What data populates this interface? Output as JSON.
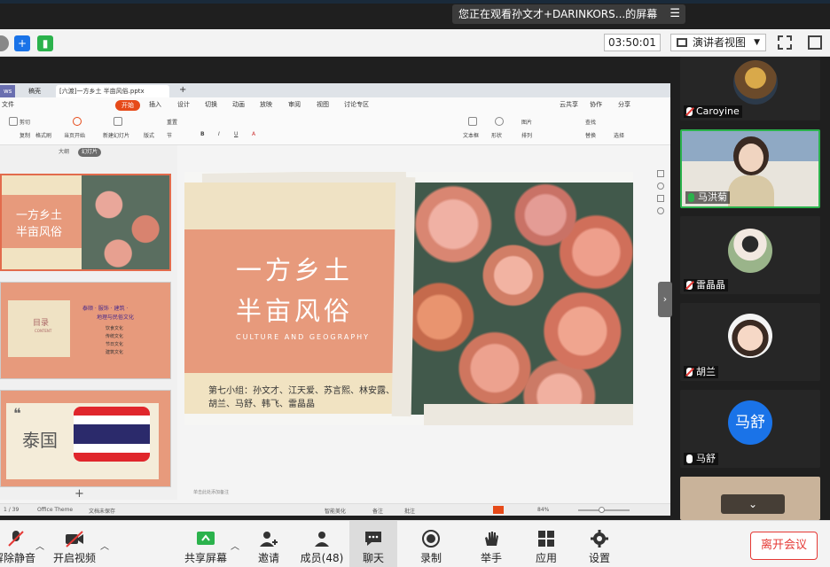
{
  "banner": {
    "text": "您正在观看孙文才+DARINKORS...的屏幕",
    "menu_icon": "menu-icon"
  },
  "meeting_bar": {
    "timer": "03:50:01",
    "view_label": "演讲者视图"
  },
  "wps": {
    "tabs": [
      "稿壳",
      "[六渡]一方乡土 半亩风俗.pptx"
    ],
    "file_menu": "文件",
    "start_tab": "开始",
    "menu_items": [
      "插入",
      "设计",
      "切换",
      "动画",
      "放映",
      "审阅",
      "视图",
      "讨论专区"
    ],
    "menu_right": [
      "云共享",
      "协作",
      "分享"
    ],
    "ribbon_items": [
      "剪切",
      "复制",
      "格式刷",
      "当页开始",
      "新建幻灯片",
      "版式",
      "节",
      "重置",
      "文本框",
      "形状",
      "图片",
      "排列",
      "查找",
      "替换",
      "选择"
    ],
    "thumb_tabs": [
      "大纲",
      "幻灯片"
    ],
    "thumb1": {
      "title1": "一方乡土",
      "title2": "半亩风俗"
    },
    "thumb2": {
      "label": "目录",
      "sub": "CONTENT",
      "heading": "泰顺 · 服饰 · 建筑 ·",
      "heading2": "地理与民俗文化",
      "items": [
        "饮食文化",
        "传统文化",
        "节日文化",
        "建筑文化"
      ]
    },
    "thumb3": {
      "quote": "❝",
      "text": "泰国"
    },
    "slide": {
      "title_line1": "一方乡土",
      "title_line2": "半亩风俗",
      "subtitle": "CULTURE AND GEOGRAPHY",
      "members": "第七小组：孙文才、江天爱、苏言熙、林安露、胡兰、马舒、韩飞、雷晶晶"
    },
    "notes_hint": "单击此处添加备注",
    "status": {
      "slide_count": "1 / 39",
      "theme": "Office Theme",
      "backup": "文档未保存",
      "beautify": "智能美化",
      "notes": "备注",
      "comment": "批注",
      "zoom": "84%"
    }
  },
  "participants": [
    {
      "name": "Caroyine",
      "mic": "off"
    },
    {
      "name": "马洪菊",
      "mic": "on"
    },
    {
      "name": "雷晶晶",
      "mic": "off"
    },
    {
      "name": "胡兰",
      "mic": "off"
    },
    {
      "name": "马舒",
      "mic": "on",
      "avatar_text": "马舒"
    },
    {
      "name": "",
      "mic": "off"
    }
  ],
  "bottom_bar": {
    "mute": "解除静音",
    "video": "开启视频",
    "share": "共享屏幕",
    "invite": "邀请",
    "members": "成员(48)",
    "chat": "聊天",
    "record": "录制",
    "raise_hand": "举手",
    "apps": "应用",
    "settings": "设置",
    "end": "离开会议"
  },
  "colors": {
    "accent_red": "#e53935",
    "active_green": "#2bb24c",
    "slide_orange": "#e79a7c",
    "slide_cream": "#efe2c4"
  }
}
